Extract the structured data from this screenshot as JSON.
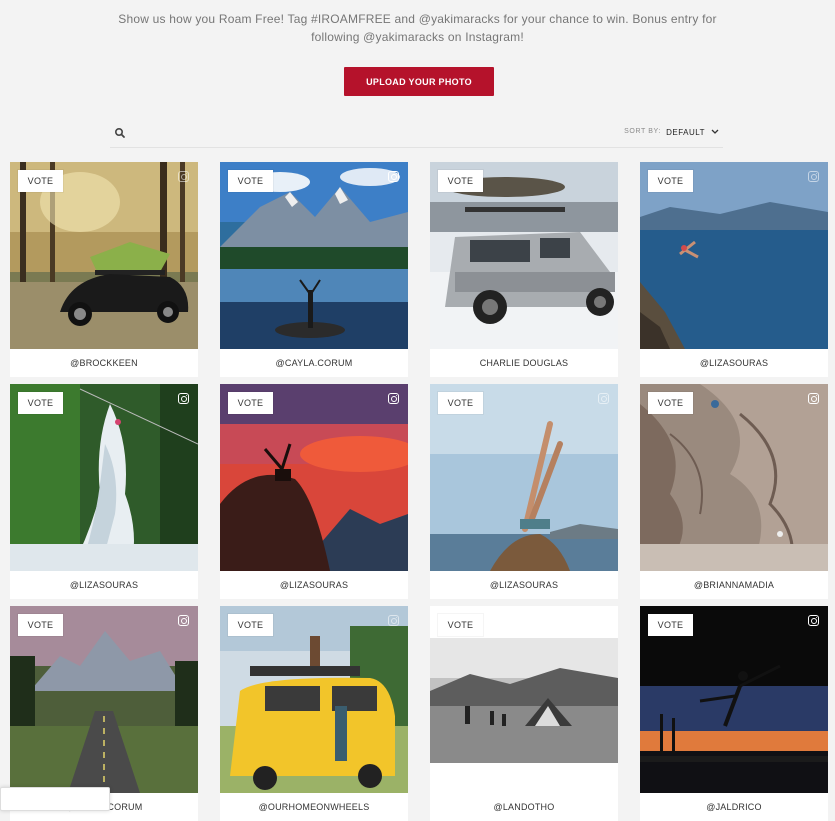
{
  "intro": {
    "line1": "Show us how you Roam Free! Tag #IROAMFREE and @yakimaracks for your chance to win. Bonus entry for",
    "line2": "following @yakimaracks on Instagram!"
  },
  "upload_label": "UPLOAD YOUR PHOTO",
  "toolbar": {
    "search_icon": "search-icon",
    "sort_label": "SORT BY:",
    "sort_value": "DEFAULT"
  },
  "vote_label": "VOTE",
  "cards": [
    {
      "caption": "@BROCKKEEN",
      "scene": "forest car with rooftop tent"
    },
    {
      "caption": "@CAYLA.CORUM",
      "scene": "mountain lake"
    },
    {
      "caption": "CHARLIE DOUGLAS",
      "scene": "snow suv with kayak"
    },
    {
      "caption": "@LIZASOURAS",
      "scene": "cliff jump lake"
    },
    {
      "caption": "@LIZASOURAS",
      "scene": "waterfall"
    },
    {
      "caption": "@LIZASOURAS",
      "scene": "red sunset"
    },
    {
      "caption": "@LIZASOURAS",
      "scene": "yoga pose lakeside"
    },
    {
      "caption": "@BRIANNAMADIA",
      "scene": "rock climbing"
    },
    {
      "caption": "@CAYLA.CORUM",
      "scene": "road into mountains"
    },
    {
      "caption": "@OURHOMEONWHEELS",
      "scene": "yellow van"
    },
    {
      "caption": "@LANDOTHO",
      "scene": "black and white camping"
    },
    {
      "caption": "@JALDRICO",
      "scene": "sunset dancer on dock"
    }
  ]
}
